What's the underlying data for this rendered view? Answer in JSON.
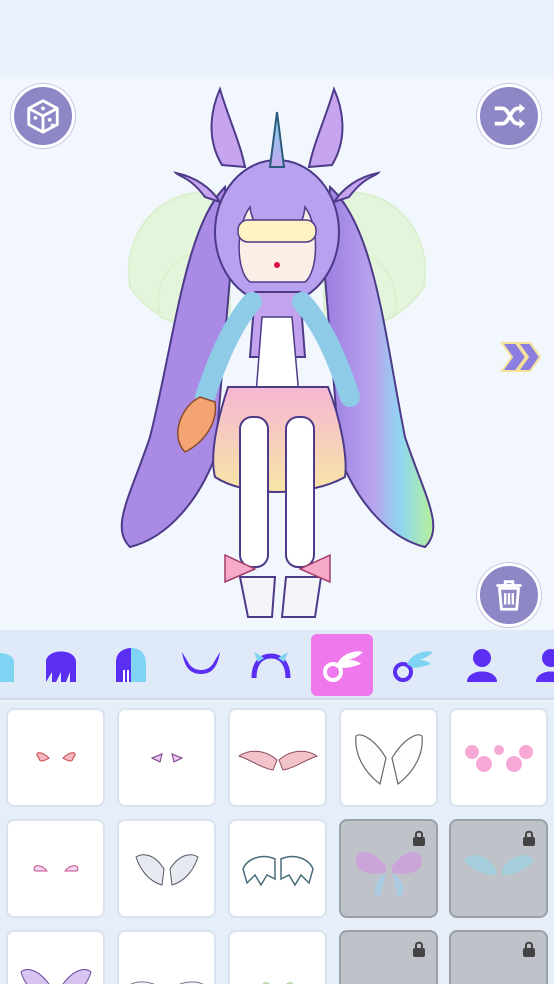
{
  "colors": {
    "button_fill": "#8d87c6",
    "tab_selected": "#ee78ec",
    "icon_purple": "#5b2ef3",
    "icon_cyan": "#7fd4f3",
    "locked_overlay": "#bfc3c9"
  },
  "toolbar": {
    "random_icon": "dice-icon",
    "shuffle_icon": "shuffle-icon",
    "delete_icon": "trash-icon",
    "next_icon": "double-chevron-right-icon"
  },
  "category_tabs": [
    {
      "icon": "hair-back-icon",
      "selected": false
    },
    {
      "icon": "hair-front-icon",
      "selected": false
    },
    {
      "icon": "hair-two-tone-icon",
      "selected": false
    },
    {
      "icon": "horns-icon",
      "selected": false
    },
    {
      "icon": "horns-outline-icon",
      "selected": false
    },
    {
      "icon": "wings-icon",
      "selected": true
    },
    {
      "icon": "wings-alt-icon",
      "selected": false
    },
    {
      "icon": "body-icon",
      "selected": false
    },
    {
      "icon": "body-alt-icon",
      "selected": false
    }
  ],
  "wing_items": [
    {
      "style": "tiny pink wings",
      "locked": false
    },
    {
      "style": "tiny bat wings",
      "locked": false
    },
    {
      "style": "pink feather wings",
      "locked": false
    },
    {
      "style": "white angel wings",
      "locked": false
    },
    {
      "style": "pink heart wings",
      "locked": false
    },
    {
      "style": "small pastel wings",
      "locked": false
    },
    {
      "style": "silver leaf wings",
      "locked": false
    },
    {
      "style": "bone bat wings",
      "locked": false
    },
    {
      "style": "butterfly wings",
      "locked": true
    },
    {
      "style": "cyan fairy wings",
      "locked": true
    },
    {
      "style": "lavender feather wings",
      "locked": false
    },
    {
      "style": "white feather wings",
      "locked": false
    },
    {
      "style": "green leaf wings",
      "locked": false
    },
    {
      "style": "purple wings",
      "locked": true
    },
    {
      "style": "small wings",
      "locked": true
    }
  ]
}
